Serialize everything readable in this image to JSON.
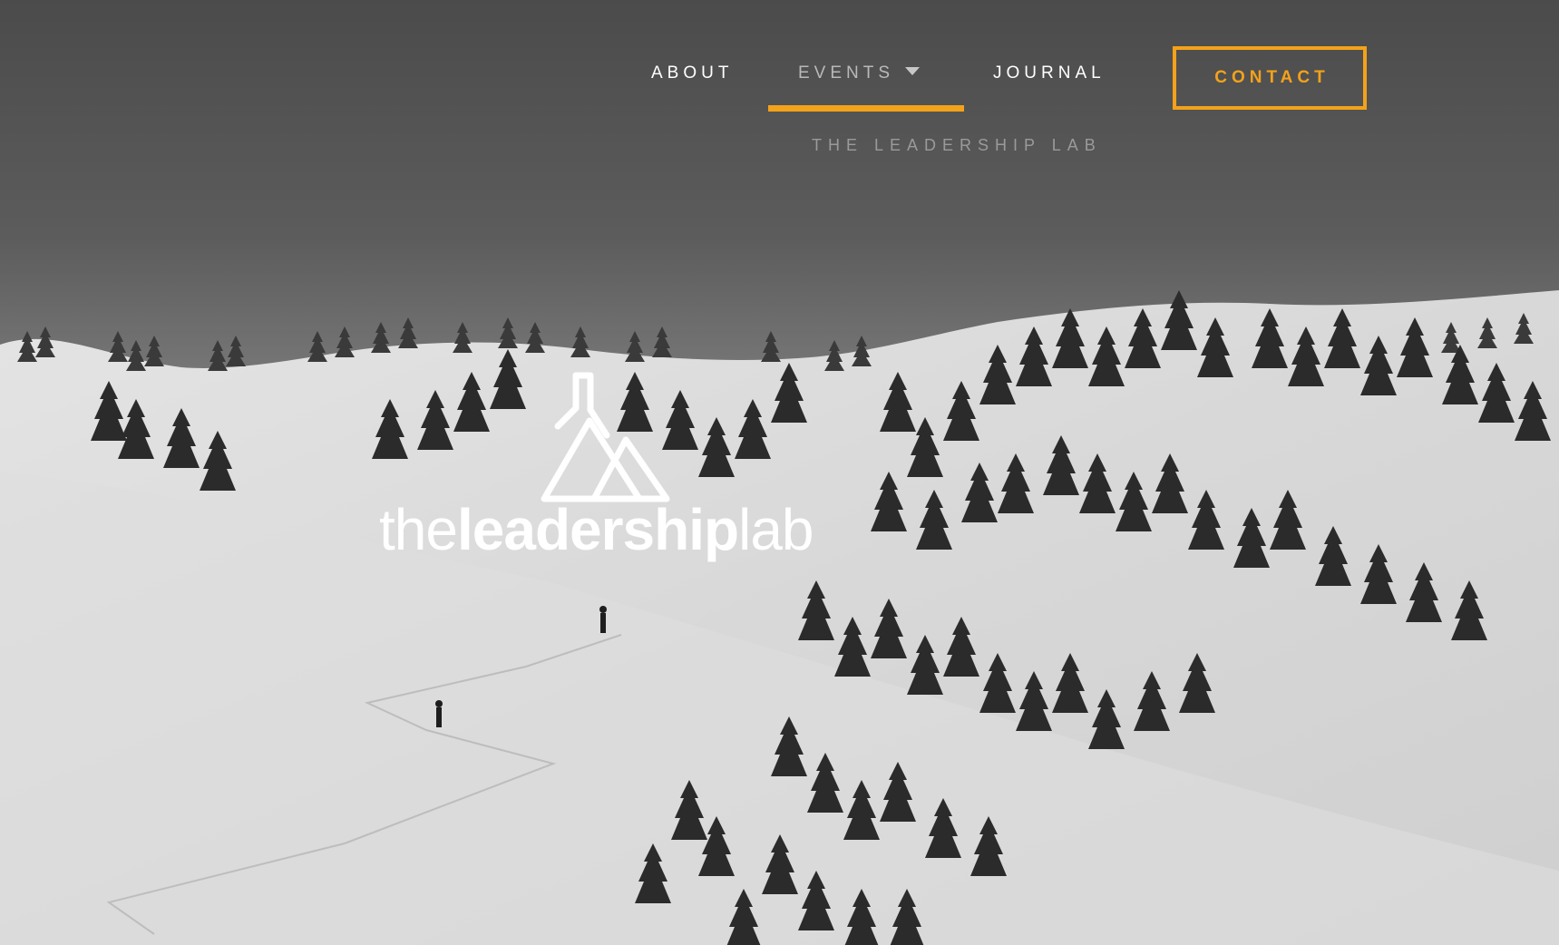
{
  "nav": {
    "items": [
      {
        "label": "ABOUT"
      },
      {
        "label": "EVENTS"
      },
      {
        "label": "JOURNAL"
      }
    ],
    "contact_label": "CONTACT",
    "submenu": {
      "items": [
        {
          "label": "THE LEADERSHIP LAB"
        }
      ]
    }
  },
  "logo": {
    "wordmark_light_prefix": "the",
    "wordmark_bold": "leadership",
    "wordmark_light_suffix": "lab",
    "icon": "flask-mountain-icon"
  },
  "colors": {
    "accent": "#f3a21a",
    "nav_text": "#ffffff",
    "nav_active_text": "#b9b9b9",
    "submenu_text": "#9a9a9a"
  }
}
